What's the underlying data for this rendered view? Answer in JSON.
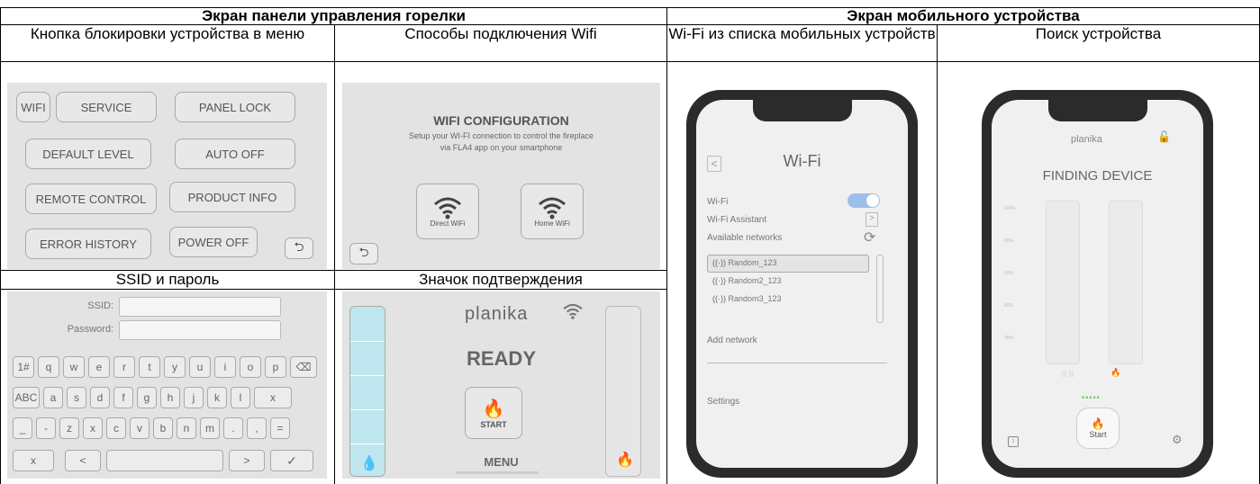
{
  "headers": {
    "left": "Экран панели управления горелки",
    "right": "Экран мобильного устройства"
  },
  "captions": {
    "menu_lock": "Кнопка блокировки устройства в меню",
    "wifi_methods": "Способы подключения Wifi",
    "wifi_list": "Wi-Fi из списка мобильных устройств",
    "device_search": "Поиск устройства",
    "ssid_password": "SSID и пароль",
    "confirm_icon": "Значок подтверждения"
  },
  "menu_panel": {
    "buttons": [
      "WIFI",
      "SERVICE",
      "PANEL LOCK",
      "DEFAULT LEVEL",
      "AUTO OFF",
      "REMOTE CONTROL",
      "PRODUCT INFO",
      "ERROR HISTORY",
      "POWER OFF"
    ]
  },
  "wifi_config": {
    "title": "WIFI CONFIGURATION",
    "subtitle1": "Setup your WI-FI connection to control the fireplace",
    "subtitle2": "via FLA4 app on your smartphone",
    "direct": "Direct WiFi",
    "home": "Home WiFi"
  },
  "keyboard": {
    "ssid_label": "SSID:",
    "password_label": "Password:",
    "row1": [
      "1#",
      "q",
      "w",
      "e",
      "r",
      "t",
      "y",
      "u",
      "i",
      "o",
      "p"
    ],
    "row2": [
      "ABC",
      "a",
      "s",
      "d",
      "f",
      "g",
      "h",
      "j",
      "k",
      "l",
      "x"
    ],
    "row3": [
      "_",
      "-",
      "z",
      "x",
      "c",
      "v",
      "b",
      "n",
      "m",
      ".",
      ",",
      "="
    ],
    "row4": [
      "x",
      "<",
      ">",
      "✓"
    ]
  },
  "ready_panel": {
    "brand": "planika",
    "status": "READY",
    "start": "START",
    "menu": "MENU"
  },
  "phone_wifi": {
    "title": "Wi-Fi",
    "wifi": "Wi-Fi",
    "assistant": "Wi-Fi Assistant",
    "available": "Available networks",
    "networks": [
      "Random_123",
      "Random2_123",
      "Random3_123"
    ],
    "add": "Add network",
    "settings": "Settings"
  },
  "phone_find": {
    "brand": "planika",
    "title": "FINDING DEVICE",
    "scale": [
      "100%",
      "80%",
      "60%",
      "40%",
      "20%"
    ],
    "start": "Start"
  }
}
